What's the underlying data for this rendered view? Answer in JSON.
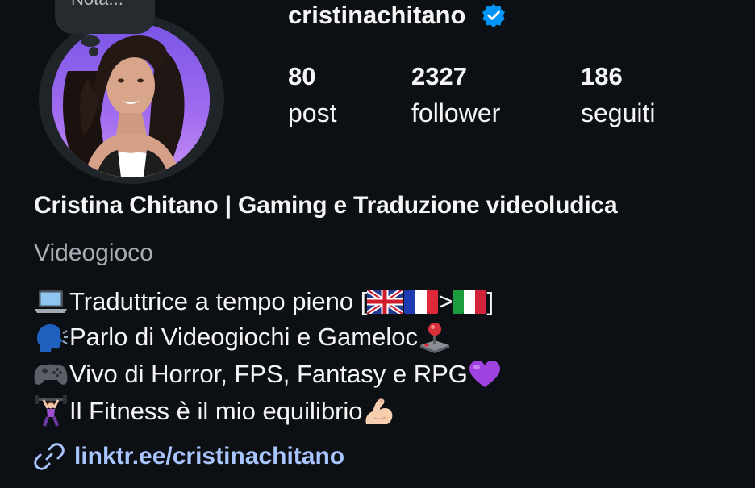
{
  "profile": {
    "note": "Nota...",
    "username": "cristinachitano",
    "stats": [
      {
        "value": "80",
        "label": "post"
      },
      {
        "value": "2327",
        "label": "follower"
      },
      {
        "value": "186",
        "label": "seguiti"
      }
    ],
    "full_name": "Cristina Chitano | Gaming e Traduzione videoludica",
    "category": "Videogioco",
    "bio": {
      "line1_text": "Traduttrice a tempo pieno [",
      "line1_arrow": " > ",
      "line1_end": "]",
      "line2_text": "Parlo di Videogiochi e Gameloc",
      "line3_text": "Vivo di Horror, FPS, Fantasy e RPG",
      "line4_text": "Il Fitness è il mio equilibrio"
    },
    "link": "linktr.ee/cristinachitano"
  },
  "icons": {
    "verified": "verified-badge-icon",
    "laptop": "laptop-emoji",
    "speaking": "speaking-head-emoji",
    "gamepad": "gamepad-emoji",
    "joystick": "joystick-emoji",
    "heart": "purple-heart-emoji",
    "weightlifter": "weightlifter-emoji",
    "muscle": "flexed-biceps-emoji",
    "link": "link-icon"
  },
  "colors": {
    "background": "#0c1014",
    "text": "#f5f5f5",
    "secondary_text": "#a8adb3",
    "link": "#a9c5ff",
    "verified": "#0095f6"
  }
}
